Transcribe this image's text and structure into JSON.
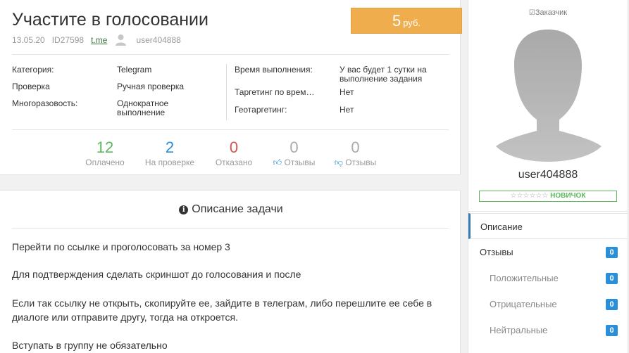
{
  "task": {
    "title": "Участите в голосовании",
    "price_amount": "5",
    "price_currency": "руб.",
    "date": "13.05.20",
    "id": "ID27598",
    "link_text": "t.me",
    "username": "user404888"
  },
  "info_left": [
    {
      "label": "Категория:",
      "value": "Telegram"
    },
    {
      "label": "Проверка",
      "value": "Ручная проверка"
    },
    {
      "label": "Многоразовость:",
      "value": "Однократное выполнение"
    }
  ],
  "info_right": [
    {
      "label": "Время выполнения:",
      "value": "У вас будет 1 сутки на выполнение задания"
    },
    {
      "label": "Таргетинг по врем…",
      "value": "Нет"
    },
    {
      "label": "Геотаргетинг:",
      "value": "Нет"
    }
  ],
  "stats": [
    {
      "value": "12",
      "label": "Оплачено",
      "color": "#5cb85c"
    },
    {
      "value": "2",
      "label": "На проверке",
      "color": "#2a8fd9"
    },
    {
      "value": "0",
      "label": "Отказано",
      "color": "#d9534f"
    },
    {
      "value": "0",
      "label": "Отзывы",
      "color": "#aaaaaa",
      "icon": "thumbs-up-icon"
    },
    {
      "value": "0",
      "label": "Отзывы",
      "color": "#aaaaaa",
      "icon": "thumbs-down-icon"
    }
  ],
  "description": {
    "title": "Описание задачи",
    "paragraphs": [
      "Перейти по ссылке и проголосовать за номер 3",
      "Для подтверждения сделать скриншот до голосования и после",
      "Если так ссылку не открыть, скопируйте ее, зайдите в телеграм, либо перешлите ее себе в диалоге или отправите другу, тогда на откроется.",
      "Вступать в группу не обязательно"
    ]
  },
  "sidebar": {
    "role": "Заказчик",
    "username": "user404888",
    "rank_stars": "☆☆☆☆☆☆",
    "rank": "НОВИЧОК",
    "menu": [
      {
        "label": "Описание"
      },
      {
        "label": "Отзывы",
        "count": "0"
      },
      {
        "label": "Положительные",
        "count": "0"
      },
      {
        "label": "Отрицательные",
        "count": "0"
      },
      {
        "label": "Нейтральные",
        "count": "0"
      }
    ]
  },
  "colors": {
    "accent_orange": "#f0ad4e",
    "badge_blue": "#2a8fd9",
    "success_green": "#5cb85c",
    "danger_red": "#d9534f"
  }
}
